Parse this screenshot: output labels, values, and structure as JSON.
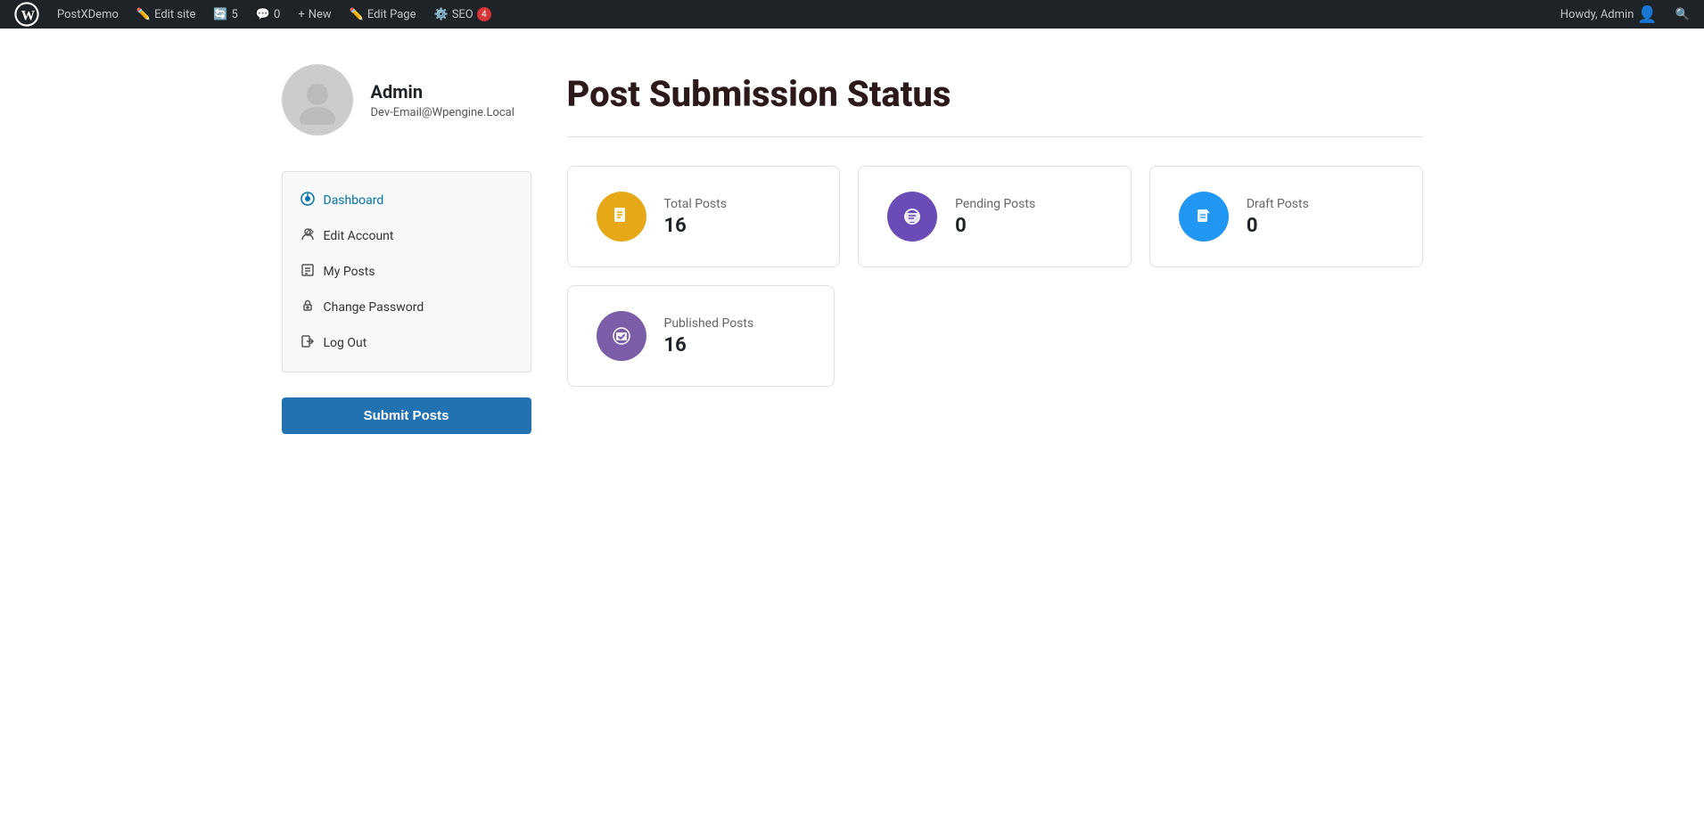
{
  "adminbar": {
    "wp_label": "WordPress",
    "site_name": "PostXDemo",
    "edit_site": "Edit site",
    "updates": "5",
    "comments": "0",
    "new_label": "New",
    "edit_page": "Edit Page",
    "seo_label": "SEO",
    "seo_badge": "4",
    "howdy": "Howdy, Admin",
    "search_label": "Search"
  },
  "profile": {
    "name": "Admin",
    "email": "Dev-Email@Wpengine.Local"
  },
  "nav": {
    "items": [
      {
        "id": "dashboard",
        "label": "Dashboard",
        "active": true
      },
      {
        "id": "edit-account",
        "label": "Edit Account",
        "active": false
      },
      {
        "id": "my-posts",
        "label": "My Posts",
        "active": false
      },
      {
        "id": "change-password",
        "label": "Change Password",
        "active": false
      },
      {
        "id": "log-out",
        "label": "Log Out",
        "active": false
      }
    ],
    "submit_label": "Submit Posts"
  },
  "main": {
    "title": "Post Submission Status",
    "stats": [
      {
        "id": "total-posts",
        "label": "Total Posts",
        "value": "16",
        "color": "orange",
        "icon": "document"
      },
      {
        "id": "pending-posts",
        "label": "Pending Posts",
        "value": "0",
        "color": "purple",
        "icon": "clock"
      },
      {
        "id": "draft-posts",
        "label": "Draft Posts",
        "value": "0",
        "color": "blue",
        "icon": "edit"
      }
    ],
    "stats2": [
      {
        "id": "published-posts",
        "label": "Published Posts",
        "value": "16",
        "color": "violet",
        "icon": "check"
      }
    ]
  }
}
